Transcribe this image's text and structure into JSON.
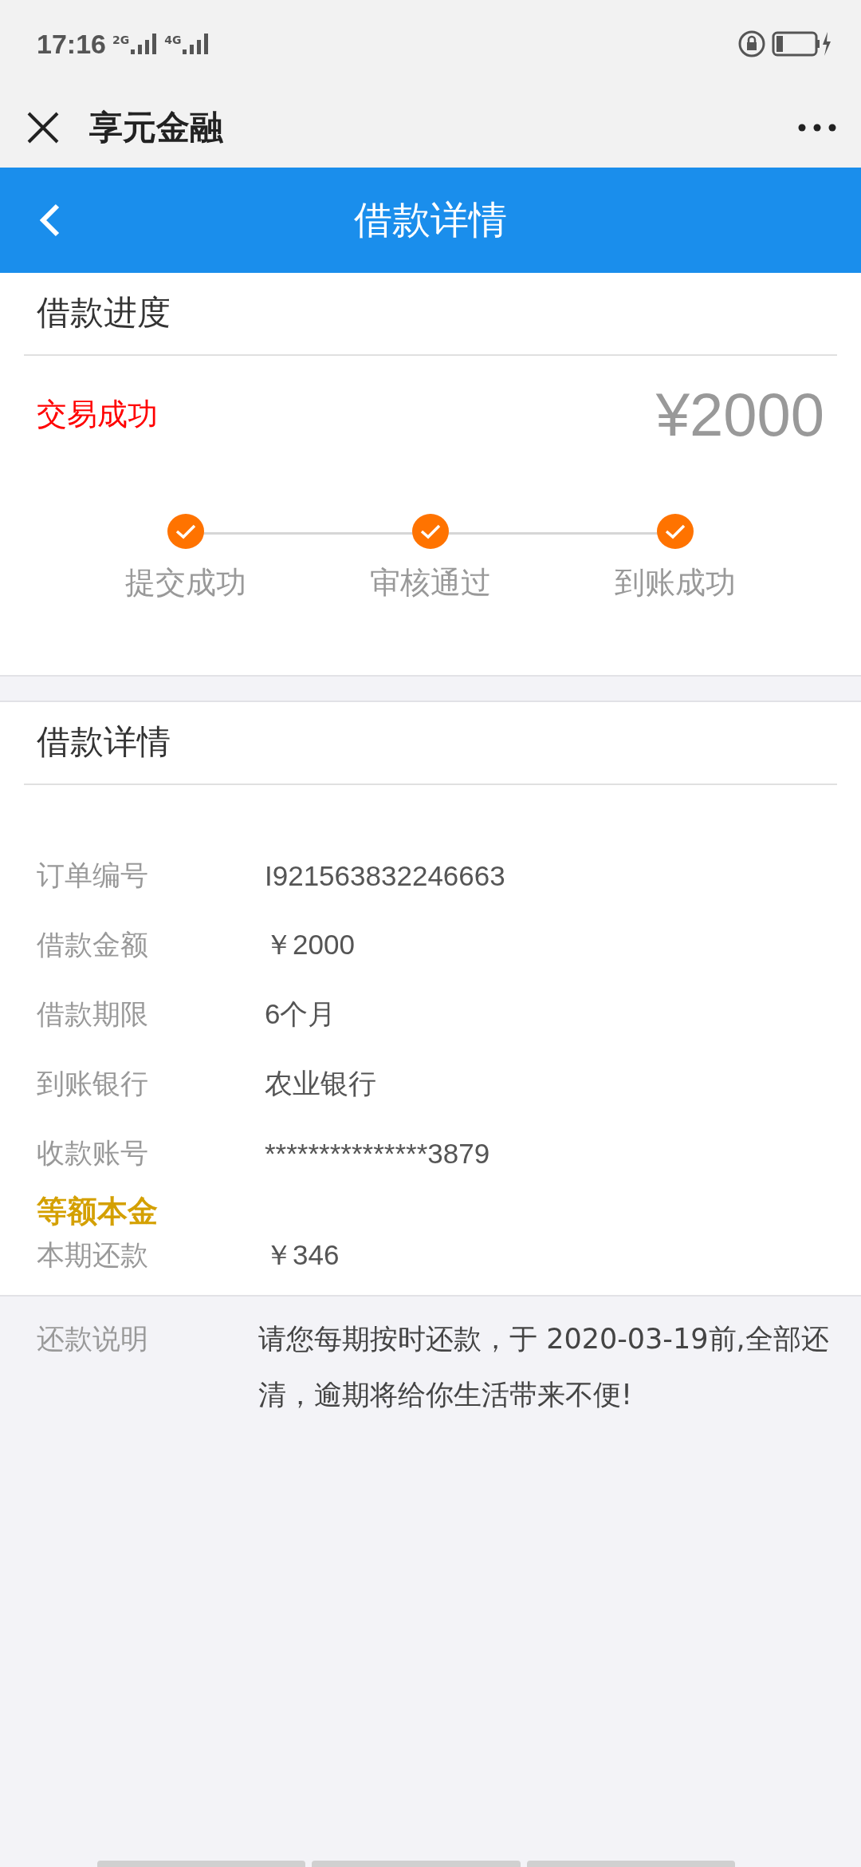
{
  "status_bar": {
    "time": "17:16",
    "signals": [
      {
        "label": "2G"
      },
      {
        "label": "4G"
      }
    ]
  },
  "title_bar": {
    "title": "享元金融"
  },
  "header": {
    "title": "借款详情"
  },
  "progress": {
    "title": "借款进度",
    "status": "交易成功",
    "amount": "¥2000",
    "steps": [
      {
        "label": "提交成功",
        "done": true
      },
      {
        "label": "审核通过",
        "done": true
      },
      {
        "label": "到账成功",
        "done": true
      }
    ]
  },
  "details": {
    "title": "借款详情",
    "rows": [
      {
        "label": "订单编号",
        "value": "I921563832246663"
      },
      {
        "label": "借款金额",
        "value": "￥2000"
      },
      {
        "label": "借款期限",
        "value": "6个月"
      },
      {
        "label": "到账银行",
        "value": "农业银行"
      },
      {
        "label": "收款账号",
        "value": "***************3879"
      }
    ],
    "plan": "等额本金",
    "installment": {
      "label": "本期还款",
      "value": "￥346"
    }
  },
  "note": {
    "label": "还款说明",
    "text": "请您每期按时还款，于 2020-03-19前,全部还清，逾期将给你生活带来不便!"
  }
}
